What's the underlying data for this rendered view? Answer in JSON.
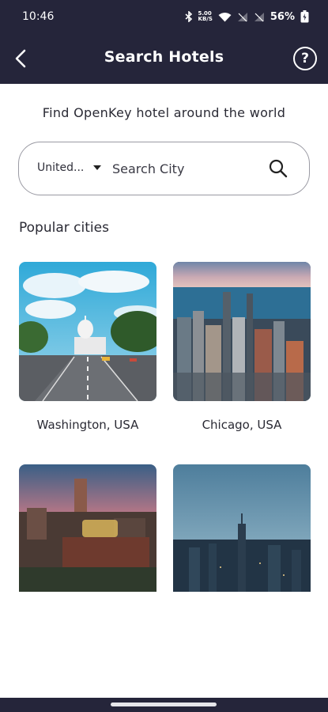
{
  "status_bar": {
    "time": "10:46",
    "network_speed": "5.00\nKB/S",
    "battery": "56%",
    "icons": [
      "bluetooth-icon",
      "wifi-icon",
      "signal-icon",
      "battery-icon"
    ]
  },
  "header": {
    "title": "Search Hotels",
    "back_icon": "chevron-left-icon",
    "help_label": "?"
  },
  "intro": {
    "text": "Find OpenKey hotel around the world"
  },
  "search": {
    "country_selected": "United...",
    "city_placeholder": "Search City",
    "city_value": ""
  },
  "popular": {
    "title": "Popular cities",
    "cities": [
      {
        "name": "Washington, USA"
      },
      {
        "name": "Chicago, USA"
      },
      {
        "name": ""
      },
      {
        "name": ""
      }
    ]
  },
  "colors": {
    "header_bg": "#25253a",
    "text": "#2a2a34",
    "border": "#9a9aa3"
  }
}
